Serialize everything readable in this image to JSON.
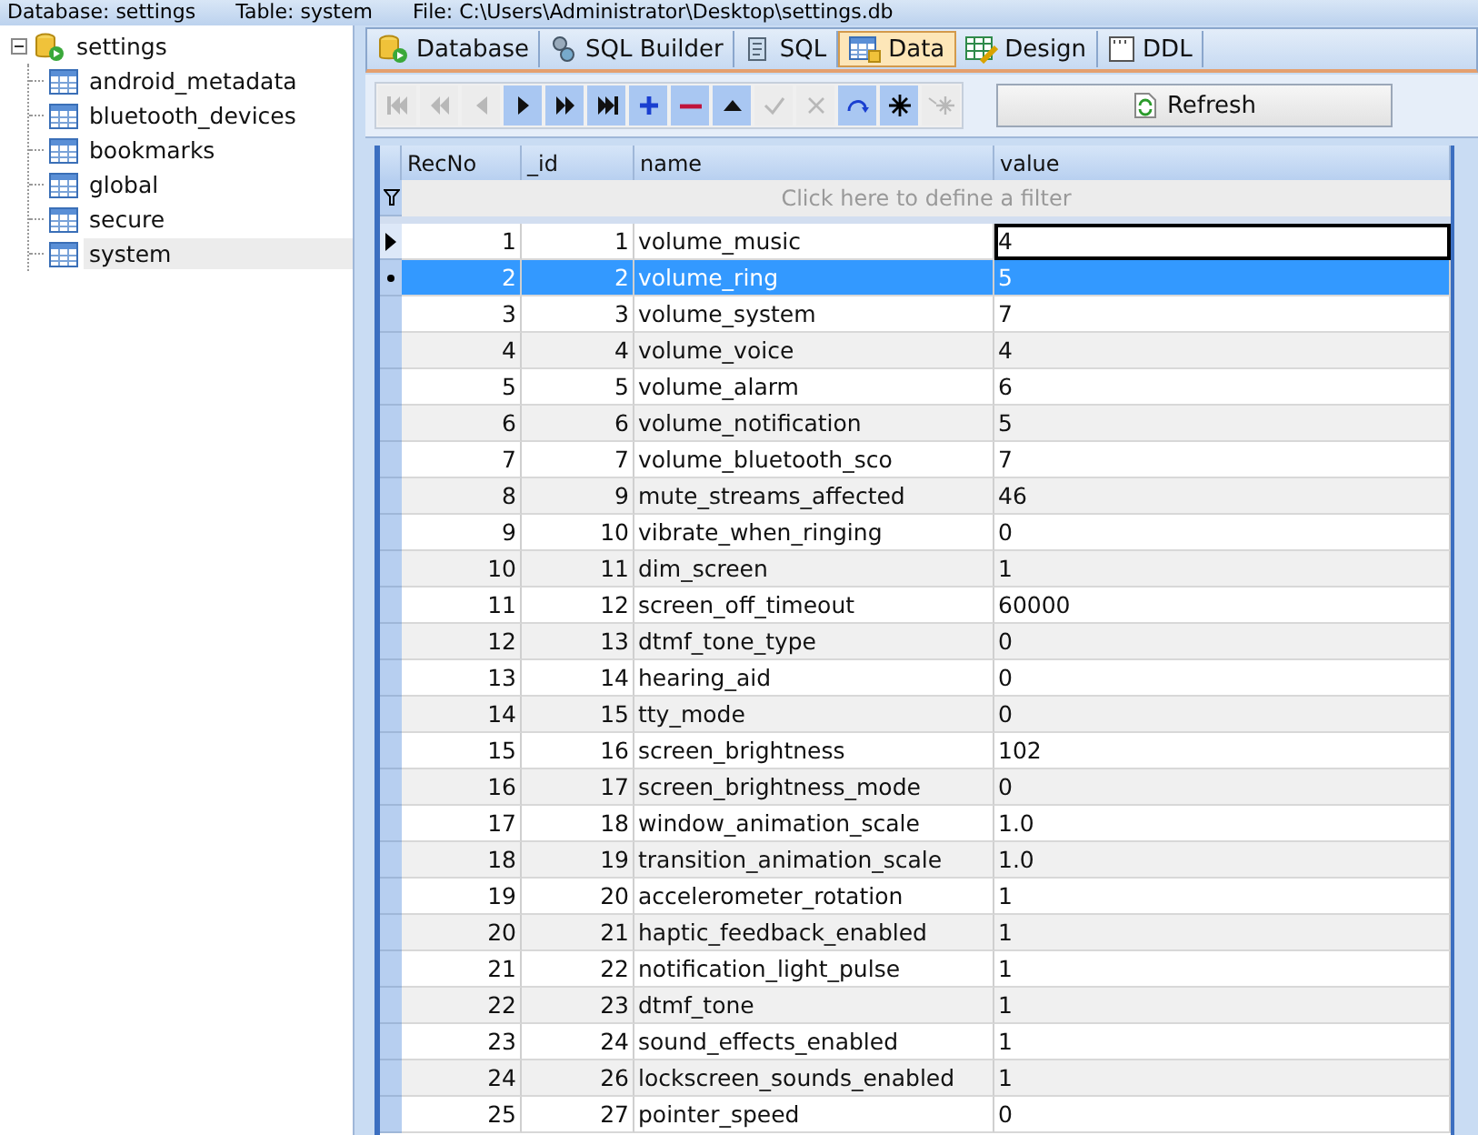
{
  "status_header": {
    "database_label": "Database: settings",
    "table_label": "Table: system",
    "file_label": "File: C:\\Users\\Administrator\\Desktop\\settings.db"
  },
  "tree": [
    {
      "label": "settings",
      "kind": "database",
      "expanded": true,
      "selected": false,
      "children": [
        {
          "label": "android_metadata",
          "kind": "table",
          "selected": false
        },
        {
          "label": "bluetooth_devices",
          "kind": "table",
          "selected": false
        },
        {
          "label": "bookmarks",
          "kind": "table",
          "selected": false
        },
        {
          "label": "global",
          "kind": "table",
          "selected": false
        },
        {
          "label": "secure",
          "kind": "table",
          "selected": false
        },
        {
          "label": "system",
          "kind": "table",
          "selected": true
        }
      ]
    }
  ],
  "tabs": [
    {
      "label": "Database",
      "kind": "database",
      "selected": false
    },
    {
      "label": "SQL Builder",
      "kind": "builder",
      "selected": false
    },
    {
      "label": "SQL",
      "kind": "sql",
      "selected": false
    },
    {
      "label": "Data",
      "kind": "data",
      "selected": true
    },
    {
      "label": "Design",
      "kind": "design",
      "selected": false
    },
    {
      "label": "DDL",
      "kind": "ddl",
      "selected": false
    }
  ],
  "navigator": [
    {
      "kind": "first",
      "disabled": true
    },
    {
      "kind": "prior-page",
      "disabled": true
    },
    {
      "kind": "prior",
      "disabled": true
    },
    {
      "kind": "next",
      "disabled": false
    },
    {
      "kind": "next-page",
      "disabled": false
    },
    {
      "kind": "last",
      "disabled": false
    },
    {
      "kind": "insert",
      "disabled": false
    },
    {
      "kind": "delete",
      "disabled": false
    },
    {
      "kind": "edit",
      "disabled": false
    },
    {
      "kind": "post",
      "disabled": true
    },
    {
      "kind": "cancel",
      "disabled": true
    },
    {
      "kind": "refresh",
      "disabled": false
    },
    {
      "kind": "apply",
      "disabled": false
    },
    {
      "kind": "cancel-updates",
      "disabled": true
    }
  ],
  "refresh_button": "Refresh",
  "table": {
    "columns": [
      "RecNo",
      "_id",
      "name",
      "value"
    ],
    "filter_hint": "Click here to define a filter",
    "rows": [
      {
        "cells": [
          "1",
          "1",
          "volume_music",
          "4"
        ],
        "current": true,
        "selected": false
      },
      {
        "cells": [
          "2",
          "2",
          "volume_ring",
          "5"
        ],
        "current": false,
        "selected": true
      },
      {
        "cells": [
          "3",
          "3",
          "volume_system",
          "7"
        ],
        "current": false,
        "selected": false
      },
      {
        "cells": [
          "4",
          "4",
          "volume_voice",
          "4"
        ],
        "current": false,
        "selected": false
      },
      {
        "cells": [
          "5",
          "5",
          "volume_alarm",
          "6"
        ],
        "current": false,
        "selected": false
      },
      {
        "cells": [
          "6",
          "6",
          "volume_notification",
          "5"
        ],
        "current": false,
        "selected": false
      },
      {
        "cells": [
          "7",
          "7",
          "volume_bluetooth_sco",
          "7"
        ],
        "current": false,
        "selected": false
      },
      {
        "cells": [
          "8",
          "9",
          "mute_streams_affected",
          "46"
        ],
        "current": false,
        "selected": false
      },
      {
        "cells": [
          "9",
          "10",
          "vibrate_when_ringing",
          "0"
        ],
        "current": false,
        "selected": false
      },
      {
        "cells": [
          "10",
          "11",
          "dim_screen",
          "1"
        ],
        "current": false,
        "selected": false
      },
      {
        "cells": [
          "11",
          "12",
          "screen_off_timeout",
          "60000"
        ],
        "current": false,
        "selected": false
      },
      {
        "cells": [
          "12",
          "13",
          "dtmf_tone_type",
          "0"
        ],
        "current": false,
        "selected": false
      },
      {
        "cells": [
          "13",
          "14",
          "hearing_aid",
          "0"
        ],
        "current": false,
        "selected": false
      },
      {
        "cells": [
          "14",
          "15",
          "tty_mode",
          "0"
        ],
        "current": false,
        "selected": false
      },
      {
        "cells": [
          "15",
          "16",
          "screen_brightness",
          "102"
        ],
        "current": false,
        "selected": false
      },
      {
        "cells": [
          "16",
          "17",
          "screen_brightness_mode",
          "0"
        ],
        "current": false,
        "selected": false
      },
      {
        "cells": [
          "17",
          "18",
          "window_animation_scale",
          "1.0"
        ],
        "current": false,
        "selected": false
      },
      {
        "cells": [
          "18",
          "19",
          "transition_animation_scale",
          "1.0"
        ],
        "current": false,
        "selected": false
      },
      {
        "cells": [
          "19",
          "20",
          "accelerometer_rotation",
          "1"
        ],
        "current": false,
        "selected": false
      },
      {
        "cells": [
          "20",
          "21",
          "haptic_feedback_enabled",
          "1"
        ],
        "current": false,
        "selected": false
      },
      {
        "cells": [
          "21",
          "22",
          "notification_light_pulse",
          "1"
        ],
        "current": false,
        "selected": false
      },
      {
        "cells": [
          "22",
          "23",
          "dtmf_tone",
          "1"
        ],
        "current": false,
        "selected": false
      },
      {
        "cells": [
          "23",
          "24",
          "sound_effects_enabled",
          "1"
        ],
        "current": false,
        "selected": false
      },
      {
        "cells": [
          "24",
          "26",
          "lockscreen_sounds_enabled",
          "1"
        ],
        "current": false,
        "selected": false
      },
      {
        "cells": [
          "25",
          "27",
          "pointer_speed",
          "0"
        ],
        "current": false,
        "selected": false
      }
    ]
  }
}
